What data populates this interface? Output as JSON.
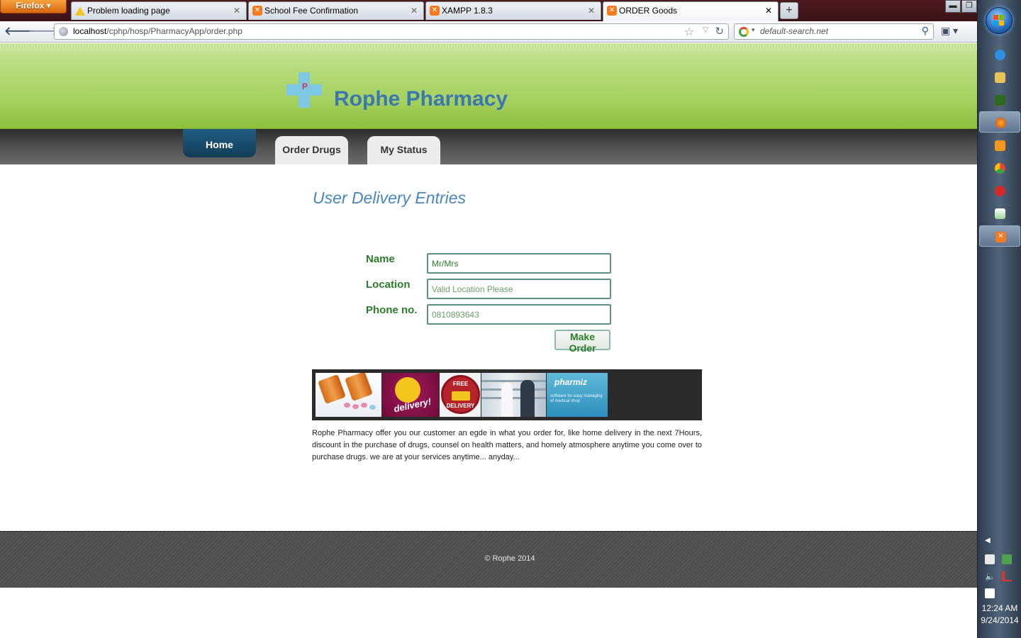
{
  "browser": {
    "app_button": "Firefox",
    "tabs": [
      {
        "title": "Problem loading page",
        "icon": "warning-icon"
      },
      {
        "title": "School Fee Confirmation",
        "icon": "xampp-icon"
      },
      {
        "title": "XAMPP 1.8.3",
        "icon": "xampp-icon"
      },
      {
        "title": "ORDER Goods",
        "icon": "xampp-icon",
        "active": true
      }
    ],
    "new_tab": "+",
    "url_host": "localhost",
    "url_path": "/cphp/hosp/PharmacyApp/order.php",
    "search_text": "default-search.net"
  },
  "site": {
    "title": "Rophe Pharmacy",
    "logo_letter": "P",
    "menu": [
      {
        "label": "Home",
        "active": true
      },
      {
        "label": "Order Drugs"
      },
      {
        "label": "My Status"
      }
    ]
  },
  "form": {
    "heading": "User Delivery Entries",
    "name_label": "Name",
    "name_value": "Mr/Mrs",
    "location_label": "Location",
    "location_placeholder": "Valid Location Please",
    "phone_label": "Phone no.",
    "phone_placeholder": "0810893643",
    "submit_label": "Make Order"
  },
  "banner": {
    "delivery_text": "delivery!",
    "free_top": "FREE",
    "free_bottom": "DELIVERY",
    "pharmiz_logo": "pharmiz",
    "pharmiz_tagline": "software for easy managing of medical shop"
  },
  "description": "Rophe Pharmacy offer you our customer an egde in what you order for, like home delivery in the next 7Hours, discount in the purchase of drugs, counsel on health matters, and homely atmosphere anytime you come over to purchase drugs. we are at your services anytime... anyday...",
  "footer": {
    "copyright": "© Rophe 2014"
  },
  "taskbar": {
    "time": "12:24 AM",
    "date": "9/24/2014"
  },
  "colors": {
    "header_green": "#a6d160",
    "title_blue": "#3c78b0",
    "label_green": "#2b7d2b",
    "footer_gray": "#4c4c4c"
  }
}
